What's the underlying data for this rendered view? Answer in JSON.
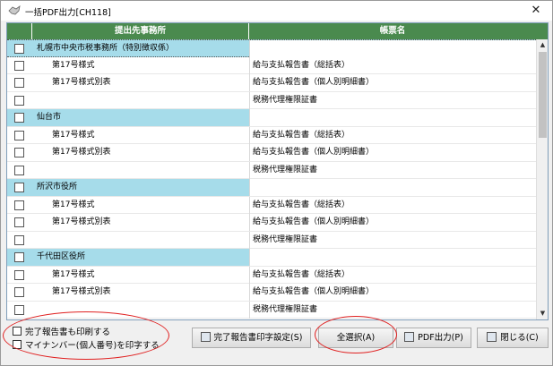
{
  "window": {
    "title": "一括PDF出力[CH118]",
    "close_glyph": "✕"
  },
  "grid": {
    "headers": {
      "office": "提出先事務所",
      "form": "帳票名"
    },
    "rows": [
      {
        "kind": "group",
        "office": "札幌市中央市税事務所（特別徴収係）",
        "form": ""
      },
      {
        "kind": "item",
        "office": "第17号様式",
        "form": "給与支払報告書（総括表）"
      },
      {
        "kind": "item",
        "office": "第17号様式別表",
        "form": "給与支払報告書（個人別明細書）"
      },
      {
        "kind": "item",
        "office": "",
        "form": "税務代理権限証書"
      },
      {
        "kind": "group",
        "office": "仙台市",
        "form": ""
      },
      {
        "kind": "item",
        "office": "第17号様式",
        "form": "給与支払報告書（総括表）"
      },
      {
        "kind": "item",
        "office": "第17号様式別表",
        "form": "給与支払報告書（個人別明細書）"
      },
      {
        "kind": "item",
        "office": "",
        "form": "税務代理権限証書"
      },
      {
        "kind": "group",
        "office": "所沢市役所",
        "form": ""
      },
      {
        "kind": "item",
        "office": "第17号様式",
        "form": "給与支払報告書（総括表）"
      },
      {
        "kind": "item",
        "office": "第17号様式別表",
        "form": "給与支払報告書（個人別明細書）"
      },
      {
        "kind": "item",
        "office": "",
        "form": "税務代理権限証書"
      },
      {
        "kind": "group",
        "office": "千代田区役所",
        "form": ""
      },
      {
        "kind": "item",
        "office": "第17号様式",
        "form": "給与支払報告書（総括表）"
      },
      {
        "kind": "item",
        "office": "第17号様式別表",
        "form": "給与支払報告書（個人別明細書）"
      },
      {
        "kind": "item",
        "office": "",
        "form": "税務代理権限証書"
      }
    ]
  },
  "options": {
    "print_completion_report": "完了報告書も印刷する",
    "print_my_number": "マイナンバー(個人番号)を印字する"
  },
  "buttons": {
    "completion_settings": "完了報告書印字設定(S)",
    "select_all": "全選択(A)",
    "pdf_output": "PDF出力(P)",
    "close": "閉じる(C)"
  },
  "colors": {
    "header_bg": "#4a8a4e",
    "group_row_bg": "#a6dcea",
    "annotation": "#e02020"
  }
}
